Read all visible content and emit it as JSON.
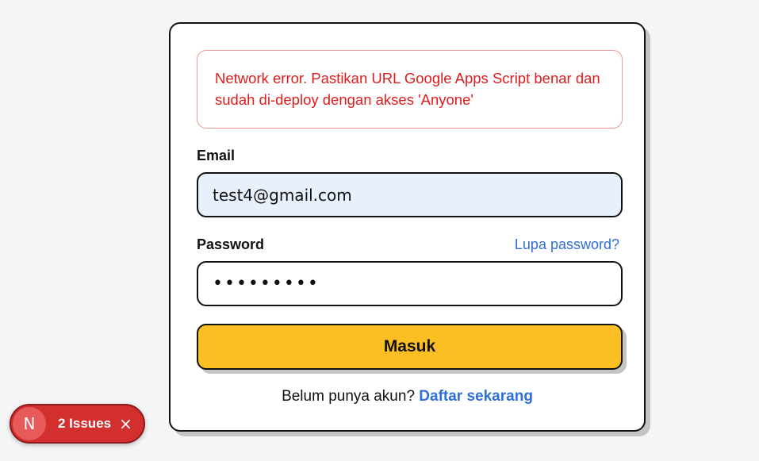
{
  "login_card": {
    "error_message": "Network error. Pastikan URL Google Apps Script benar dan sudah di-deploy dengan akses 'Anyone'",
    "email_label": "Email",
    "email_value": "test4@gmail.com",
    "password_label": "Password",
    "forgot_password_link": "Lupa password?",
    "password_value": "•••••••••",
    "submit_label": "Masuk",
    "signup_prompt": "Belum punya akun?",
    "signup_link": "Daftar sekarang"
  },
  "dev_overlay": {
    "logo_letter": "N",
    "issues_label": "2 Issues",
    "close_glyph": "×"
  },
  "colors": {
    "accent_button": "#fbbf24",
    "link": "#2f6fd6",
    "error": "#e01b1b",
    "issues_badge": "#d32f2f"
  }
}
